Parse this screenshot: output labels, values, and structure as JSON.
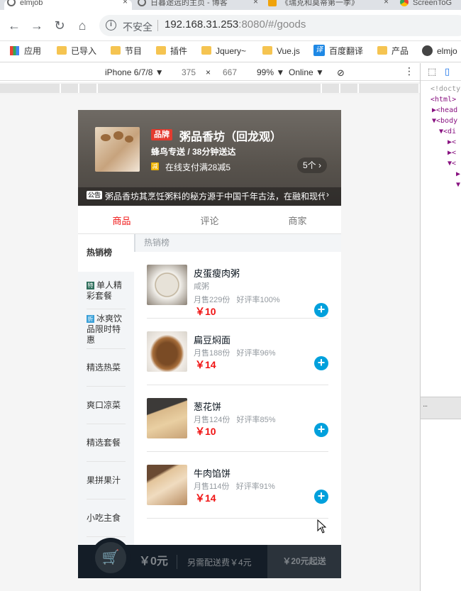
{
  "browser": {
    "tabs": [
      {
        "title": "elmjob",
        "close": "×"
      },
      {
        "title": "日暮途远的主页 - 博客",
        "close": "×"
      },
      {
        "title": "《瑞克和莫蒂第一季》",
        "close": "×"
      },
      {
        "title": "ScreenToG",
        "close": ""
      }
    ],
    "security": "不安全",
    "url_host": "192.168.31.253",
    "url_rest": ":8080/#/goods",
    "bookmarks": [
      "应用",
      "已导入",
      "节目",
      "插件",
      "Jquery~",
      "Vue.js",
      "百度翻译",
      "产品",
      "elmjo"
    ],
    "translate_icon": "译"
  },
  "devtools_toolbar": {
    "device": "iPhone 6/7/8 ▼",
    "width": "375",
    "times": "×",
    "height": "667",
    "zoom": "99% ▼",
    "network": "Online ▼"
  },
  "devtools_panel": {
    "lines": [
      "<!docty",
      "<html>",
      "▶<head",
      "▼<body",
      "▼<di",
      "▶<",
      "▶<",
      "▼<",
      "▶",
      "▼"
    ],
    "drag_handle": "..."
  },
  "seller": {
    "brand_badge": "品牌",
    "name": "粥品香坊（回龙观）",
    "delivery": "蜂鸟专送 / 38分钟送达",
    "support_icon": "减",
    "support": "在线支付满28减5",
    "support_count": "5个 ›",
    "bulletin_icon": "公告",
    "bulletin": "粥品香坊其烹饪粥料的秘方源于中国千年古法，在融和现代制作工艺",
    "bulletin_arrow": "›"
  },
  "tabs": [
    "商品",
    "评论",
    "商家"
  ],
  "menu": [
    {
      "label": "热销榜",
      "tag": "",
      "tag_color": ""
    },
    {
      "label": "单人精彩套餐",
      "tag": "特",
      "tag_color": "#2f6f5c"
    },
    {
      "label": "冰爽饮品限时特惠",
      "tag": "折",
      "tag_color": "#3aa0d8"
    },
    {
      "label": "精选热菜",
      "tag": "",
      "tag_color": ""
    },
    {
      "label": "爽口凉菜",
      "tag": "",
      "tag_color": ""
    },
    {
      "label": "精选套餐",
      "tag": "",
      "tag_color": ""
    },
    {
      "label": "果拼果汁",
      "tag": "",
      "tag_color": ""
    },
    {
      "label": "小吃主食",
      "tag": "",
      "tag_color": ""
    }
  ],
  "category_title": "热销榜",
  "foods": [
    {
      "name": "皮蛋瘦肉粥",
      "desc": "咸粥",
      "sell": "月售229份",
      "rating": "好评率100%",
      "price": "￥10",
      "add": "+"
    },
    {
      "name": "扁豆焖面",
      "desc": "",
      "sell": "月售188份",
      "rating": "好评率96%",
      "price": "￥14",
      "add": "+"
    },
    {
      "name": "葱花饼",
      "desc": "",
      "sell": "月售124份",
      "rating": "好评率85%",
      "price": "￥10",
      "add": "+"
    },
    {
      "name": "牛肉馅饼",
      "desc": "",
      "sell": "月售114份",
      "rating": "好评率91%",
      "price": "￥14",
      "add": "+"
    }
  ],
  "cart": {
    "icon": "🛒",
    "price": "￥0元",
    "delivery": "另需配送费￥4元",
    "min": "￥20元起送"
  },
  "colors": {
    "accent_red": "#f01414",
    "plus_blue": "#00a0dc",
    "cart_bg": "#141d27"
  }
}
